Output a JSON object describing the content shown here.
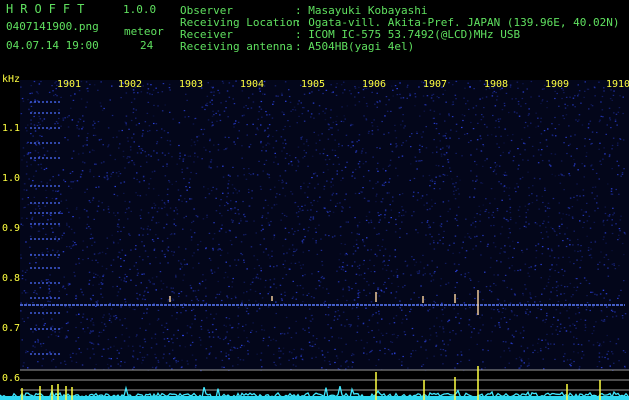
{
  "header": {
    "brand": "HROFFT",
    "version": "1.0.0",
    "filename": "0407141900.png",
    "datetime": "04.07.14 19:00",
    "meteor_label": "meteor",
    "meteor_count": "24",
    "observer_label": "Observer",
    "observer_value": ": Masayuki Kobayashi",
    "location_label": "Receiving Location",
    "location_value": ": Ogata-vill. Akita-Pref. JAPAN (139.96E, 40.02N)",
    "receiver_label": "Receiver",
    "receiver_value": ": ICOM IC-575 53.7492(@LCD)MHz USB",
    "antenna_label": "Receiving antenna",
    "antenna_value": ": A504HB(yagi 4el)"
  },
  "plot": {
    "y_unit": "kHz",
    "y_ticks": [
      "1.1",
      "1.0",
      "0.9",
      "0.8",
      "0.7",
      "0.6"
    ],
    "x_ticks": [
      "1901",
      "1902",
      "1903",
      "1904",
      "1905",
      "1906",
      "1907",
      "1908",
      "1909",
      "1910"
    ]
  },
  "colors": {
    "label_green": "#5fe05f",
    "label_yellow": "#ffff40",
    "background": "#000000",
    "noise_blue": "#2040ff",
    "trace_cyan": "#40e8ff"
  }
}
